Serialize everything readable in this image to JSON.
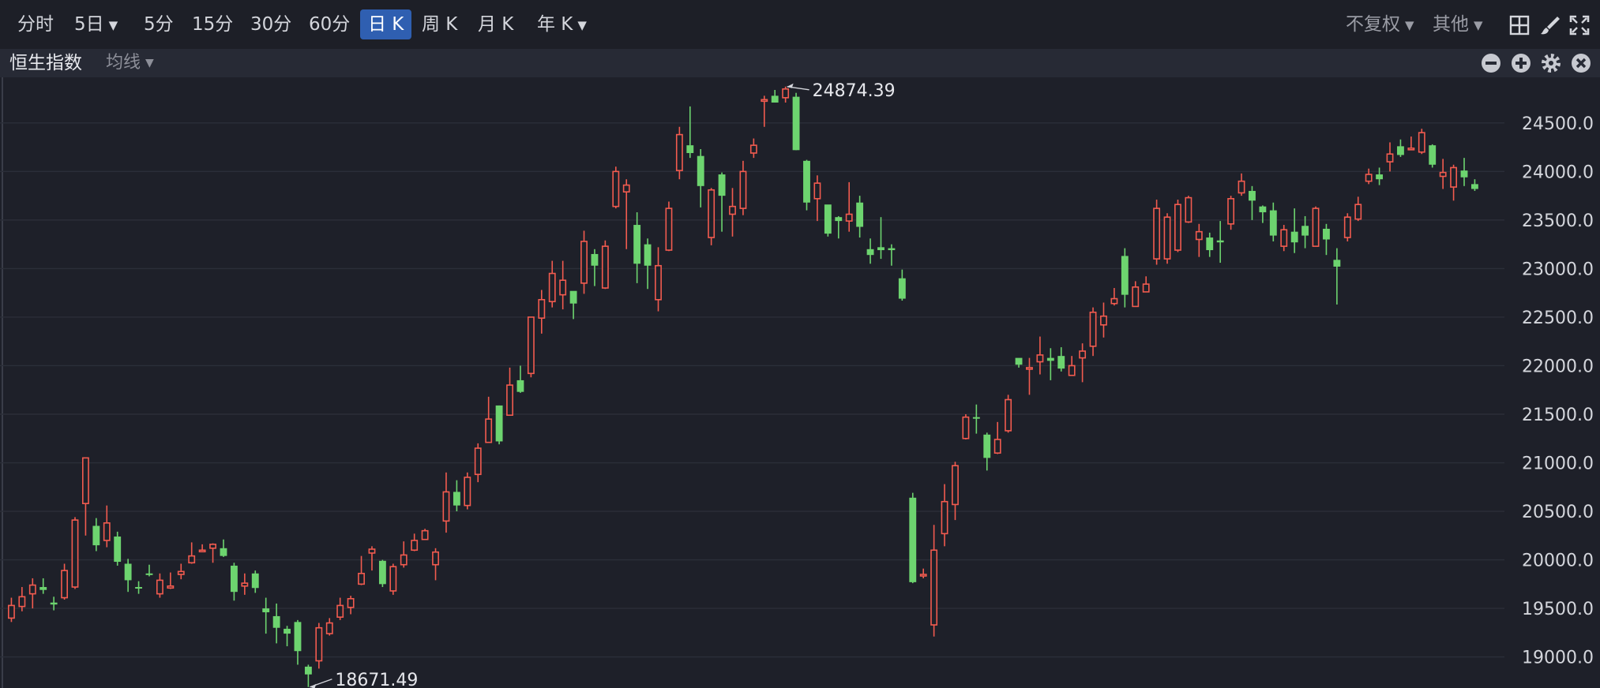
{
  "toolbar": {
    "periods": [
      "分时",
      "5日",
      "5分",
      "15分",
      "30分",
      "60分",
      "日 K",
      "周 K",
      "月 K",
      "年 K"
    ],
    "active_period": "日 K",
    "adjust": "不复权",
    "other": "其他"
  },
  "subbar": {
    "title": "恒生指数",
    "ma": "均线"
  },
  "colors": {
    "up": "#f25b4f",
    "down": "#6dd46f",
    "background": "#1e2029",
    "grid": "#2b2e39",
    "active": "#2f5fb1"
  },
  "icons": [
    "chevron-down-icon",
    "grid-layout-icon",
    "brush-icon",
    "fullscreen-icon",
    "minus-circle-icon",
    "plus-circle-icon",
    "gear-icon",
    "close-circle-icon"
  ],
  "chart_data": {
    "type": "candlestick",
    "title": "恒生指数",
    "y_ticks": [
      "24500.0",
      "24000.0",
      "23500.0",
      "23000.0",
      "22500.0",
      "22000.0",
      "21500.0",
      "21000.0",
      "20500.0",
      "20000.0",
      "19500.0",
      "19000.0"
    ],
    "ylim": [
      18680,
      24970
    ],
    "grid": true,
    "high_label": "24874.39",
    "low_label": "18671.49",
    "ohlc": [
      [
        19400,
        19530,
        19610,
        19360
      ],
      [
        19520,
        19620,
        19720,
        19470
      ],
      [
        19650,
        19740,
        19810,
        19500
      ],
      [
        19720,
        19690,
        19810,
        19650
      ],
      [
        19560,
        19540,
        19620,
        19480
      ],
      [
        19610,
        19890,
        19960,
        19590
      ],
      [
        19720,
        20410,
        20440,
        19700
      ],
      [
        20580,
        21050,
        21050,
        20250
      ],
      [
        20350,
        20150,
        20430,
        20090
      ],
      [
        20200,
        20380,
        20560,
        20130
      ],
      [
        20240,
        19980,
        20290,
        19940
      ],
      [
        19960,
        19790,
        20010,
        19670
      ],
      [
        19720,
        19710,
        19780,
        19650
      ],
      [
        19860,
        19850,
        19950,
        19830
      ],
      [
        19650,
        19790,
        19860,
        19610
      ],
      [
        19710,
        19730,
        19870,
        19700
      ],
      [
        19850,
        19880,
        19960,
        19800
      ],
      [
        19970,
        20040,
        20180,
        19960
      ],
      [
        20090,
        20100,
        20160,
        20080
      ],
      [
        20120,
        20160,
        20170,
        19970
      ],
      [
        20120,
        20040,
        20210,
        20030
      ],
      [
        19940,
        19670,
        19970,
        19580
      ],
      [
        19730,
        19760,
        19860,
        19640
      ],
      [
        19860,
        19710,
        19890,
        19660
      ],
      [
        19500,
        19460,
        19610,
        19240
      ],
      [
        19420,
        19300,
        19550,
        19140
      ],
      [
        19290,
        19240,
        19320,
        19110
      ],
      [
        19360,
        19060,
        19380,
        18920
      ],
      [
        18900,
        18820,
        18920,
        18690
      ],
      [
        18960,
        19300,
        19350,
        18880
      ],
      [
        19240,
        19350,
        19400,
        19220
      ],
      [
        19410,
        19530,
        19610,
        19380
      ],
      [
        19510,
        19600,
        19630,
        19440
      ],
      [
        19750,
        19860,
        20040,
        19740
      ],
      [
        20070,
        20110,
        20140,
        19890
      ],
      [
        19990,
        19750,
        20000,
        19720
      ],
      [
        19680,
        19930,
        19960,
        19640
      ],
      [
        19950,
        20050,
        20190,
        19920
      ],
      [
        20100,
        20200,
        20270,
        20090
      ],
      [
        20210,
        20300,
        20320,
        20210
      ],
      [
        19950,
        20080,
        20120,
        19790
      ],
      [
        20400,
        20700,
        20900,
        20280
      ],
      [
        20700,
        20560,
        20820,
        20500
      ],
      [
        20560,
        20850,
        20900,
        20520
      ],
      [
        20880,
        21150,
        21200,
        20800
      ],
      [
        21210,
        21450,
        21680,
        21210
      ],
      [
        21590,
        21220,
        21590,
        21190
      ],
      [
        21490,
        21800,
        21980,
        21490
      ],
      [
        21850,
        21730,
        22000,
        21720
      ],
      [
        21920,
        22500,
        22490,
        21880
      ],
      [
        22490,
        22680,
        22780,
        22330
      ],
      [
        22660,
        22950,
        23080,
        22600
      ],
      [
        22730,
        22880,
        23080,
        22580
      ],
      [
        22770,
        22640,
        22750,
        22480
      ],
      [
        22850,
        23280,
        23390,
        22740
      ],
      [
        23150,
        23030,
        23200,
        22820
      ],
      [
        22800,
        23230,
        23290,
        22790
      ],
      [
        23640,
        24000,
        24050,
        23620
      ],
      [
        23790,
        23860,
        23920,
        23200
      ],
      [
        23450,
        23050,
        23580,
        22850
      ],
      [
        23250,
        23030,
        23310,
        22790
      ],
      [
        22680,
        23030,
        23220,
        22560
      ],
      [
        23190,
        23620,
        23690,
        23180
      ],
      [
        24010,
        24380,
        24460,
        23920
      ],
      [
        24270,
        24190,
        24670,
        24140
      ],
      [
        24160,
        23850,
        24230,
        23630
      ],
      [
        23320,
        23810,
        23830,
        23240
      ],
      [
        23970,
        23750,
        23990,
        23380
      ],
      [
        23560,
        23640,
        23830,
        23330
      ],
      [
        23620,
        24000,
        24110,
        23550
      ],
      [
        24190,
        24270,
        24340,
        24140
      ],
      [
        24740,
        24740,
        24780,
        24460
      ],
      [
        24780,
        24710,
        24840,
        24710
      ],
      [
        24760,
        24850,
        24874.39,
        24710
      ],
      [
        24770,
        24220,
        24810,
        24220
      ],
      [
        24110,
        23680,
        24120,
        23600
      ],
      [
        23720,
        23880,
        23960,
        23490
      ],
      [
        23660,
        23360,
        23640,
        23330
      ],
      [
        23530,
        23490,
        23540,
        23310
      ],
      [
        23490,
        23560,
        23890,
        23380
      ],
      [
        23680,
        23430,
        23750,
        23320
      ],
      [
        23200,
        23140,
        23310,
        23050
      ],
      [
        23220,
        23190,
        23530,
        23100
      ],
      [
        23210,
        23190,
        23250,
        23030
      ],
      [
        22900,
        22690,
        22990,
        22670
      ],
      [
        20640,
        19770,
        20690,
        19760
      ],
      [
        19850,
        19850,
        19910,
        19810
      ],
      [
        19330,
        20100,
        20360,
        19210
      ],
      [
        20270,
        20600,
        20780,
        20140
      ],
      [
        20570,
        20970,
        21010,
        20410
      ],
      [
        21250,
        21470,
        21500,
        21240
      ],
      [
        21470,
        21460,
        21600,
        21300
      ],
      [
        21290,
        21050,
        21310,
        20920
      ],
      [
        21100,
        21240,
        21420,
        21090
      ],
      [
        21330,
        21650,
        21700,
        21310
      ],
      [
        22080,
        22010,
        22050,
        21980
      ],
      [
        21970,
        21980,
        22080,
        21700
      ],
      [
        22040,
        22110,
        22300,
        21910
      ],
      [
        22080,
        22050,
        22180,
        21850
      ],
      [
        22100,
        21970,
        22190,
        21940
      ],
      [
        21900,
        22000,
        22100,
        21910
      ],
      [
        22080,
        22150,
        22230,
        21830
      ],
      [
        22200,
        22550,
        22600,
        22100
      ],
      [
        22420,
        22510,
        22650,
        22290
      ],
      [
        22640,
        22690,
        22800,
        22620
      ],
      [
        23130,
        22730,
        23210,
        22600
      ],
      [
        22610,
        22810,
        22870,
        22610
      ],
      [
        22760,
        22840,
        22920,
        22760
      ],
      [
        23100,
        23620,
        23710,
        23040
      ],
      [
        23100,
        23530,
        23570,
        23050
      ],
      [
        23190,
        23660,
        23710,
        23170
      ],
      [
        23480,
        23730,
        23750,
        23470
      ],
      [
        23300,
        23380,
        23460,
        23120
      ],
      [
        23320,
        23190,
        23370,
        23120
      ],
      [
        23290,
        23270,
        23490,
        23060
      ],
      [
        23460,
        23720,
        23750,
        23400
      ],
      [
        23780,
        23900,
        23980,
        23750
      ],
      [
        23800,
        23700,
        23850,
        23500
      ],
      [
        23640,
        23580,
        23650,
        23470
      ],
      [
        23600,
        23340,
        23680,
        23280
      ],
      [
        23230,
        23400,
        23450,
        23180
      ],
      [
        23380,
        23270,
        23620,
        23160
      ],
      [
        23440,
        23340,
        23540,
        23210
      ],
      [
        23230,
        23620,
        23640,
        23250
      ],
      [
        23410,
        23300,
        23460,
        23140
      ],
      [
        23090,
        23020,
        23210,
        22630
      ],
      [
        23320,
        23530,
        23570,
        23280
      ],
      [
        23510,
        23660,
        23740,
        23490
      ],
      [
        23900,
        23970,
        24030,
        23870
      ],
      [
        23970,
        23920,
        24040,
        23860
      ],
      [
        24100,
        24180,
        24300,
        24000
      ],
      [
        24260,
        24170,
        24330,
        24150
      ],
      [
        24230,
        24240,
        24360,
        24230
      ],
      [
        24200,
        24400,
        24440,
        24180
      ],
      [
        24270,
        24070,
        24280,
        24040
      ],
      [
        23950,
        23990,
        24130,
        23820
      ],
      [
        23840,
        24040,
        24070,
        23700
      ],
      [
        24010,
        23940,
        24140,
        23850
      ],
      [
        23870,
        23820,
        23920,
        23800
      ]
    ]
  }
}
